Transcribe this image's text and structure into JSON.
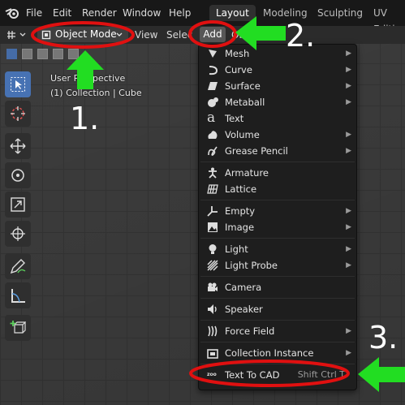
{
  "topbar": {
    "menus": [
      "File",
      "Edit",
      "Render",
      "Window",
      "Help"
    ],
    "workspaces": [
      "Layout",
      "Modeling",
      "Sculpting",
      "UV Editi"
    ]
  },
  "header": {
    "mode_label": "Object Mode",
    "view_label": "View",
    "select_label": "Selec",
    "add_label": "Add",
    "obj_label": "Ob"
  },
  "viewport": {
    "perspective": "User Perspective",
    "collection": "(1) Collection | Cube"
  },
  "add_menu": {
    "items": [
      {
        "label": "Mesh",
        "icon": "mesh-icon",
        "submenu": true
      },
      {
        "label": "Curve",
        "icon": "curve-icon",
        "submenu": true
      },
      {
        "label": "Surface",
        "icon": "surface-icon",
        "submenu": true
      },
      {
        "label": "Metaball",
        "icon": "metaball-icon",
        "submenu": true
      },
      {
        "label": "Text",
        "icon": "text-icon",
        "submenu": false
      },
      {
        "label": "Volume",
        "icon": "volume-icon",
        "submenu": true
      },
      {
        "label": "Grease Pencil",
        "icon": "grease-pencil-icon",
        "submenu": true
      },
      {
        "label": "Armature",
        "icon": "armature-icon",
        "submenu": false
      },
      {
        "label": "Lattice",
        "icon": "lattice-icon",
        "submenu": false
      },
      {
        "label": "Empty",
        "icon": "empty-icon",
        "submenu": true
      },
      {
        "label": "Image",
        "icon": "image-icon",
        "submenu": true
      },
      {
        "label": "Light",
        "icon": "light-icon",
        "submenu": true
      },
      {
        "label": "Light Probe",
        "icon": "light-probe-icon",
        "submenu": true
      },
      {
        "label": "Camera",
        "icon": "camera-icon",
        "submenu": false
      },
      {
        "label": "Speaker",
        "icon": "speaker-icon",
        "submenu": false
      },
      {
        "label": "Force Field",
        "icon": "force-field-icon",
        "submenu": true
      },
      {
        "label": "Collection Instance",
        "icon": "collection-icon",
        "submenu": true
      },
      {
        "label": "Text To CAD",
        "icon": "zoo-icon",
        "submenu": false,
        "shortcut": "Shift Ctrl T"
      }
    ]
  },
  "annotations": {
    "step1": "1.",
    "step2": "2.",
    "step3": "3.",
    "highlight_color": "#e01010",
    "arrow_color": "#22dd22"
  }
}
